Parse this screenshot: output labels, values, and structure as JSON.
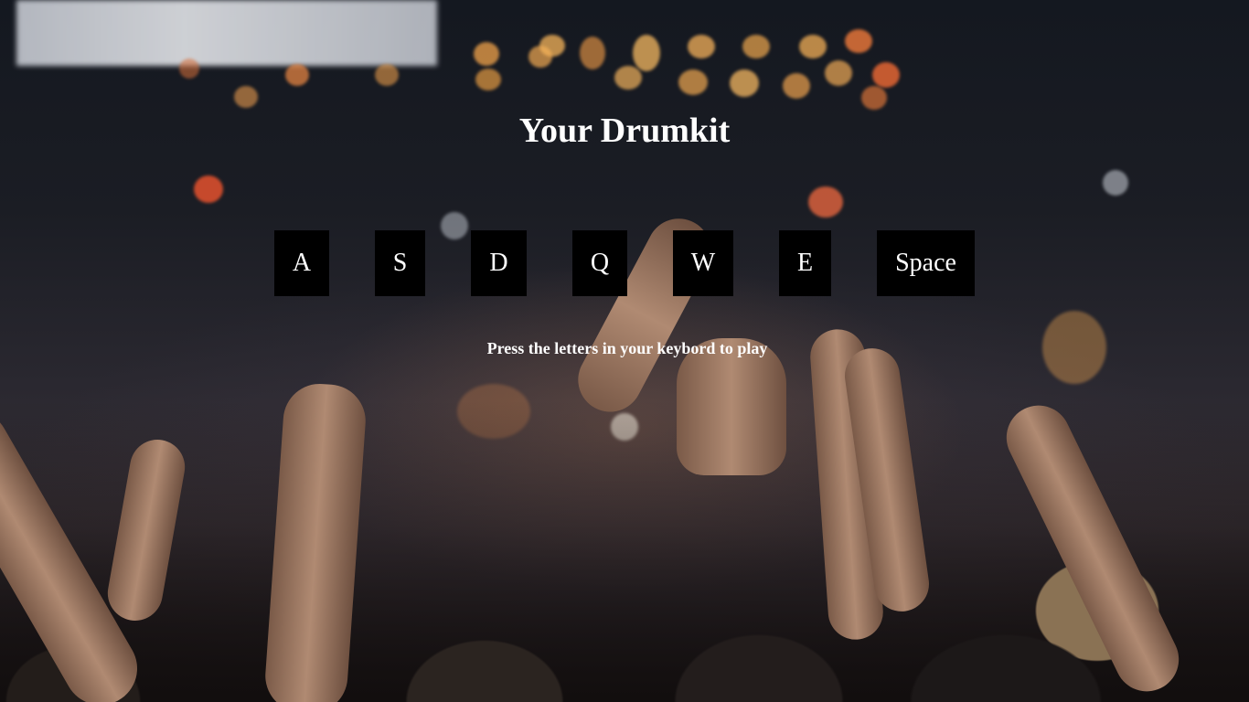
{
  "page": {
    "title": "Your Drumkit",
    "instructions": "Press the letters in your keybord to play"
  },
  "drum_keys": [
    "A",
    "S",
    "D",
    "Q",
    "W",
    "E",
    "Space"
  ],
  "colors": {
    "key_background": "#000000",
    "text": "#ffffff"
  }
}
